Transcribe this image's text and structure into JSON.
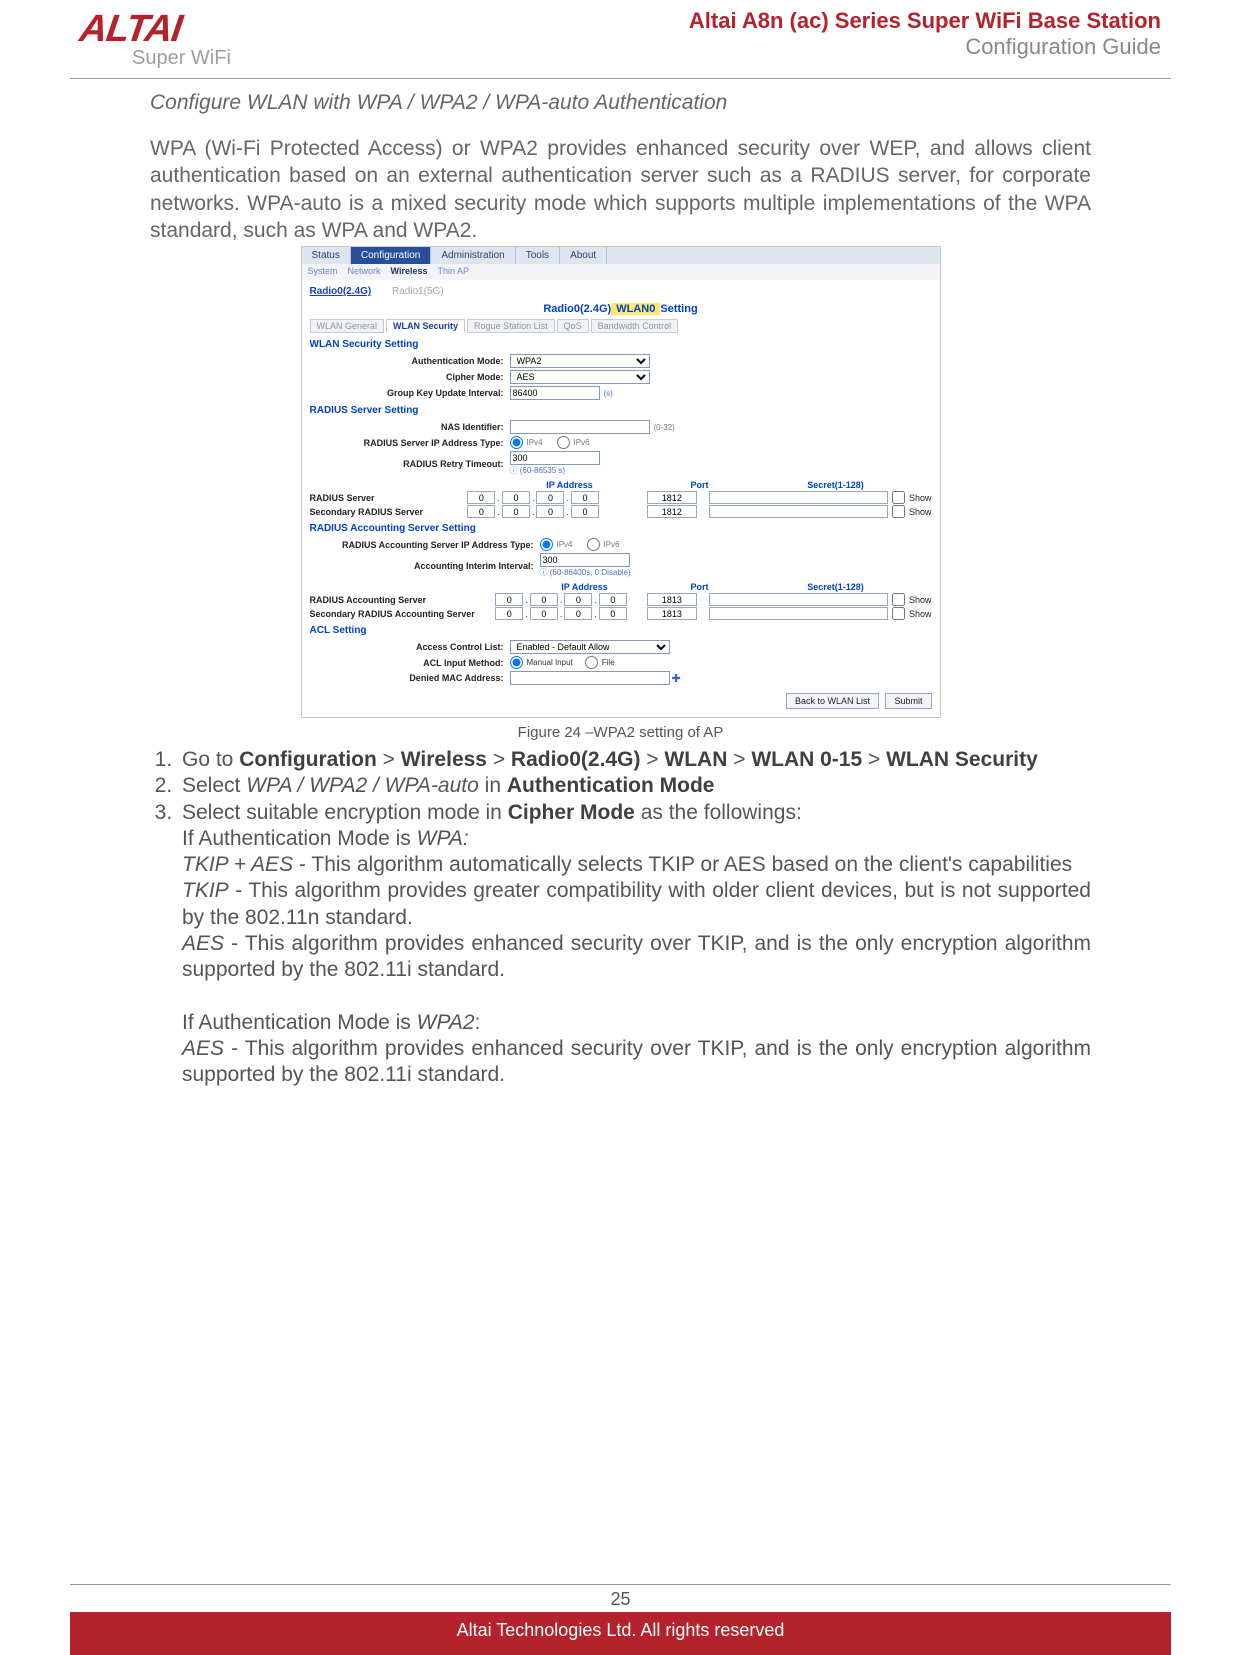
{
  "header": {
    "logo_text": "ALTAI",
    "logo_sub": "Super WiFi",
    "doc_title": "Altai A8n (ac) Series Super WiFi Base Station",
    "doc_subtitle": "Configuration Guide"
  },
  "section_title": "Configure WLAN with WPA / WPA2 / WPA-auto Authentication",
  "intro_paragraph": "WPA (Wi-Fi Protected Access) or WPA2 provides enhanced security over WEP, and allows client authentication based on an external authentication server such as a RADIUS server, for corporate networks. WPA-auto is a mixed security mode which supports multiple implementations of the WPA standard, such as WPA and WPA2.",
  "screenshot": {
    "top_tabs": [
      "Status",
      "Configuration",
      "Administration",
      "Tools",
      "About"
    ],
    "top_tabs_active": 1,
    "sub_tabs": [
      "System",
      "Network",
      "Wireless",
      "Thin AP"
    ],
    "sub_tabs_active": 2,
    "radio_links": {
      "active": "Radio0(2.4G)",
      "muted": "Radio1(5G)"
    },
    "wlan_title_parts": {
      "r0": "Radio0(2.4G)",
      "wl0": " WLAN0 ",
      "set": "Setting"
    },
    "tiny_tabs": [
      "WLAN General",
      "WLAN Security",
      "Rogue Station List",
      "QoS",
      "Bandwidth Control"
    ],
    "tiny_tabs_active": 1,
    "blue_heads": {
      "wlan_sec": "WLAN Security Setting",
      "radius": "RADIUS Server Setting",
      "radius_acct": "RADIUS Accounting Server Setting",
      "acl": "ACL Setting"
    },
    "fields": {
      "auth_mode_label": "Authentication Mode:",
      "auth_mode_value": "WPA2",
      "cipher_label": "Cipher Mode:",
      "cipher_value": "AES",
      "gku_label": "Group Key Update Interval:",
      "gku_value": "86400",
      "gku_unit": "(s)",
      "nas_label": "NAS Identifier:",
      "nas_range": "(0-32)",
      "radius_iptype_label": "RADIUS Server IP Address Type:",
      "ipv4": "IPv4",
      "ipv6": "IPv6",
      "retry_label": "RADIUS Retry Timeout:",
      "retry_value": "300",
      "retry_hint": "(60-86535 s)",
      "acct_iptype_label": "RADIUS Accounting Server IP Address Type:",
      "acct_interval_label": "Accounting Interim Interval:",
      "acct_interval_value": "300",
      "acct_interval_hint": "(60-86400s, 0:Disable)",
      "acl_list_label": "Access Control List:",
      "acl_list_value": "Enabled - Default Allow",
      "acl_input_label": "ACL Input Method:",
      "acl_manual": "Manual Input",
      "acl_file": "File",
      "denied_mac_label": "Denied MAC Address:"
    },
    "table_heads": {
      "ip": "IP Address",
      "port": "Port",
      "secret": "Secret(1-128)"
    },
    "radius_rows": [
      {
        "name": "RADIUS Server",
        "ip": [
          "0",
          "0",
          "0",
          "0"
        ],
        "port": "1812",
        "show": "Show"
      },
      {
        "name": "Secondary RADIUS Server",
        "ip": [
          "0",
          "0",
          "0",
          "0"
        ],
        "port": "1812",
        "show": "Show"
      }
    ],
    "acct_rows": [
      {
        "name": "RADIUS Accounting Server",
        "ip": [
          "0",
          "0",
          "0",
          "0"
        ],
        "port": "1813",
        "show": "Show"
      },
      {
        "name": "Secondary RADIUS Accounting Server",
        "ip": [
          "0",
          "0",
          "0",
          "0"
        ],
        "port": "1813",
        "show": "Show"
      }
    ],
    "buttons": {
      "back": "Back to WLAN List",
      "submit": "Submit"
    }
  },
  "figure_caption": "Figure 24 –WPA2 setting of AP",
  "steps": {
    "s1_pre": "Go to ",
    "s1_b1": "Configuration",
    "s1_gt": " > ",
    "s1_b2": "Wireless",
    "s1_b3": "Radio0(2.4G)",
    "s1_b4": "WLAN",
    "s1_b5": "WLAN 0-15",
    "s1_b6": "WLAN Security",
    "s2_pre": "Select ",
    "s2_it": "WPA / WPA2 / WPA-auto",
    "s2_mid": " in ",
    "s2_b": "Authentication Mode",
    "s3_pre": "Select suitable encryption mode in ",
    "s3_b": "Cipher Mode",
    "s3_post": " as the followings:",
    "s3_line1_pre": "If Authentication Mode is ",
    "s3_line1_it": "WPA:",
    "s3_tkip_aes_it": "TKIP + AES",
    "s3_tkip_aes_txt": " - This algorithm automatically selects TKIP or AES based on the client's capabilities",
    "s3_tkip_it": "TKIP",
    "s3_tkip_txt": " - This algorithm provides greater compatibility with older client devices, but is not supported by the 802.11n standard.",
    "s3_aes_it": "AES",
    "s3_aes_txt": " - This algorithm provides enhanced security over TKIP, and is the only encryption algorithm supported by the 802.11i standard.",
    "s3_line2_pre": "If Authentication Mode is ",
    "s3_line2_it": "WPA2",
    "s3_line2_post": ":",
    "s3_aes2_it": "AES",
    "s3_aes2_txt": " - This algorithm provides enhanced security over TKIP, and is the only encryption algorithm supported by the 802.11i standard."
  },
  "footer": {
    "page_number": "25",
    "copyright": "Altai Technologies Ltd. All rights reserved"
  }
}
